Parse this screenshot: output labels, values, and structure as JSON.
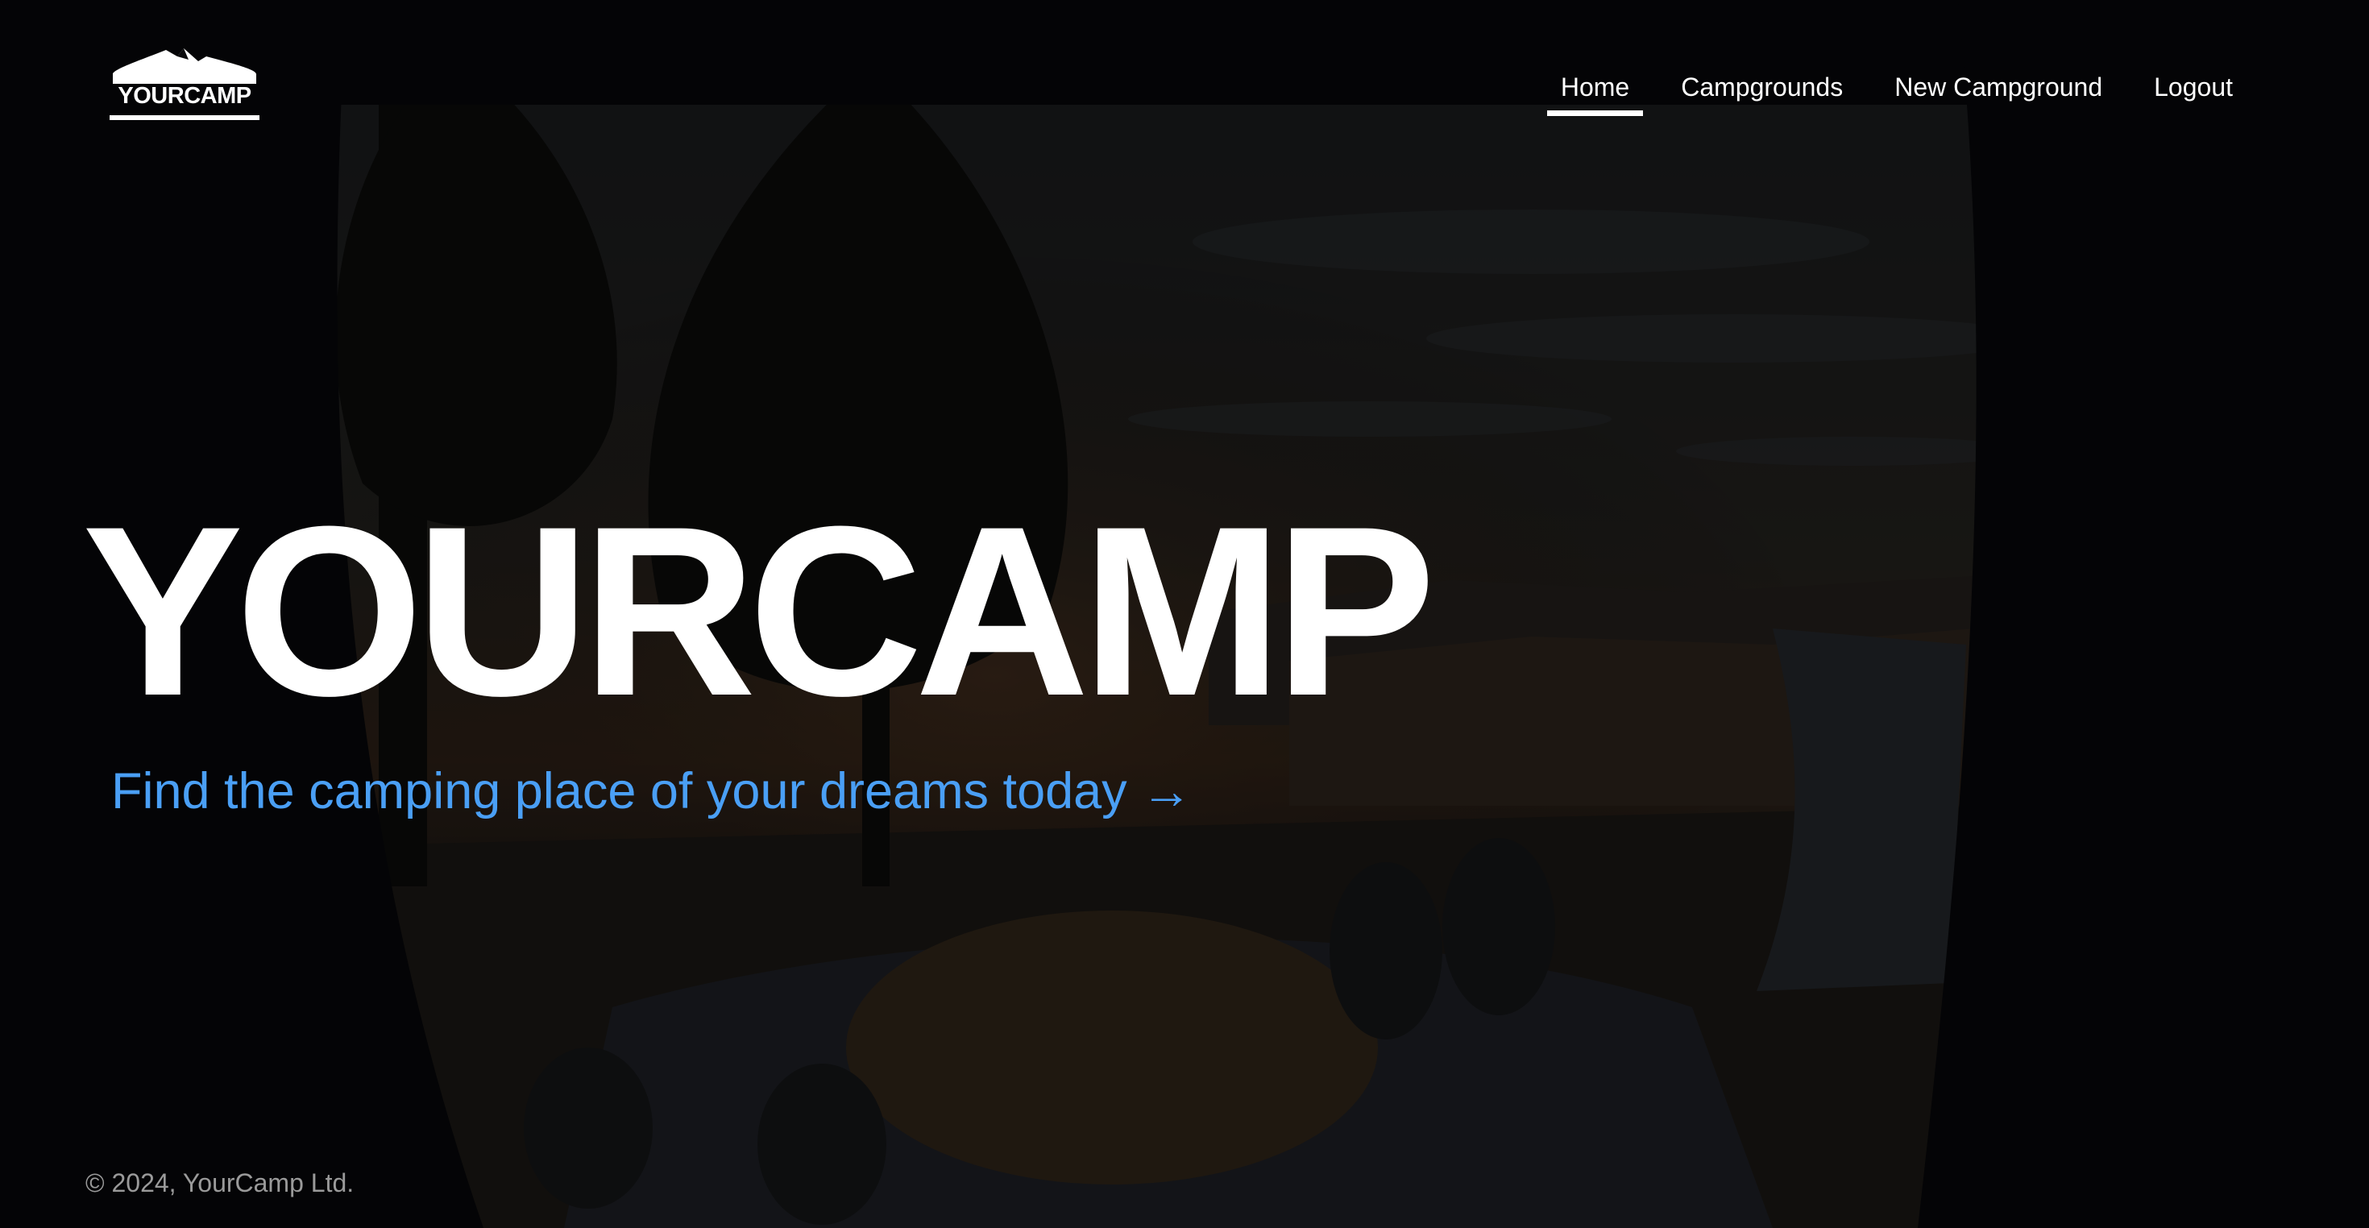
{
  "brand": {
    "logo_text": "YOURCAMP"
  },
  "nav": {
    "items": [
      {
        "label": "Home",
        "active": true
      },
      {
        "label": "Campgrounds",
        "active": false
      },
      {
        "label": "New Campground",
        "active": false
      },
      {
        "label": "Logout",
        "active": false
      }
    ]
  },
  "hero": {
    "title": "YOURCAMP",
    "link_text": "Find the camping place of your dreams today →"
  },
  "footer": {
    "copyright": "© 2024, YourCamp Ltd."
  },
  "colors": {
    "accent": "#4a9ff5",
    "text": "#ffffff",
    "footer_text": "#9a9a9a",
    "background": "#0a0a0c"
  },
  "background_image": {
    "subject": "view from open van tailgate at dusk: pine trees, canyon, sleeping dog and feet in sleeping bags"
  }
}
